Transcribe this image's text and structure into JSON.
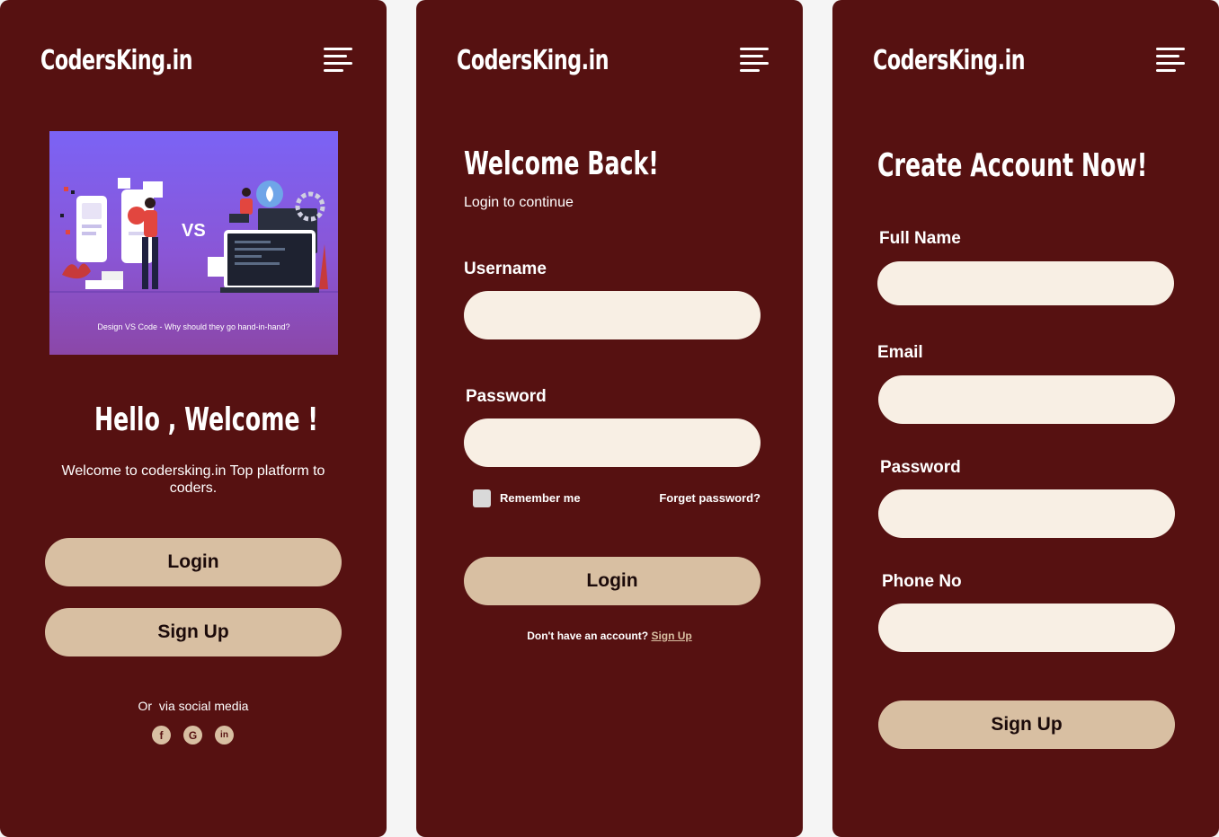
{
  "brand": "CodersKing.in",
  "colors": {
    "panel_bg": "#561111",
    "button_bg": "#d8bfa2",
    "field_bg": "#f8efe4",
    "page_bg": "#f5f5f5"
  },
  "welcome_screen": {
    "hero_caption": "Design VS Code - Why should they go hand-in-hand?",
    "hero_vs": "VS",
    "title": "Hello , Welcome !",
    "subtitle": "Welcome to codersking.in Top platform to coders.",
    "login_button": "Login",
    "signup_button": "Sign Up",
    "social_text": "Or  via social media",
    "social_icons": [
      "facebook-icon",
      "google-icon",
      "linkedin-icon"
    ],
    "social_glyphs": [
      "f",
      "G",
      "in"
    ]
  },
  "login_screen": {
    "title": "Welcome Back!",
    "subtitle": "Login to continue",
    "username_label": "Username",
    "username_value": "",
    "password_label": "Password",
    "password_value": "",
    "remember_label": "Remember me",
    "forgot_link": "Forget password?",
    "login_button": "Login",
    "no_account_text": "Don't have an account?",
    "signup_link": "Sign Up"
  },
  "signup_screen": {
    "title": "Create Account Now!",
    "fullname_label": "Full Name",
    "email_label": "Email",
    "password_label": "Password",
    "phone_label": "Phone No",
    "signup_button": "Sign Up"
  }
}
